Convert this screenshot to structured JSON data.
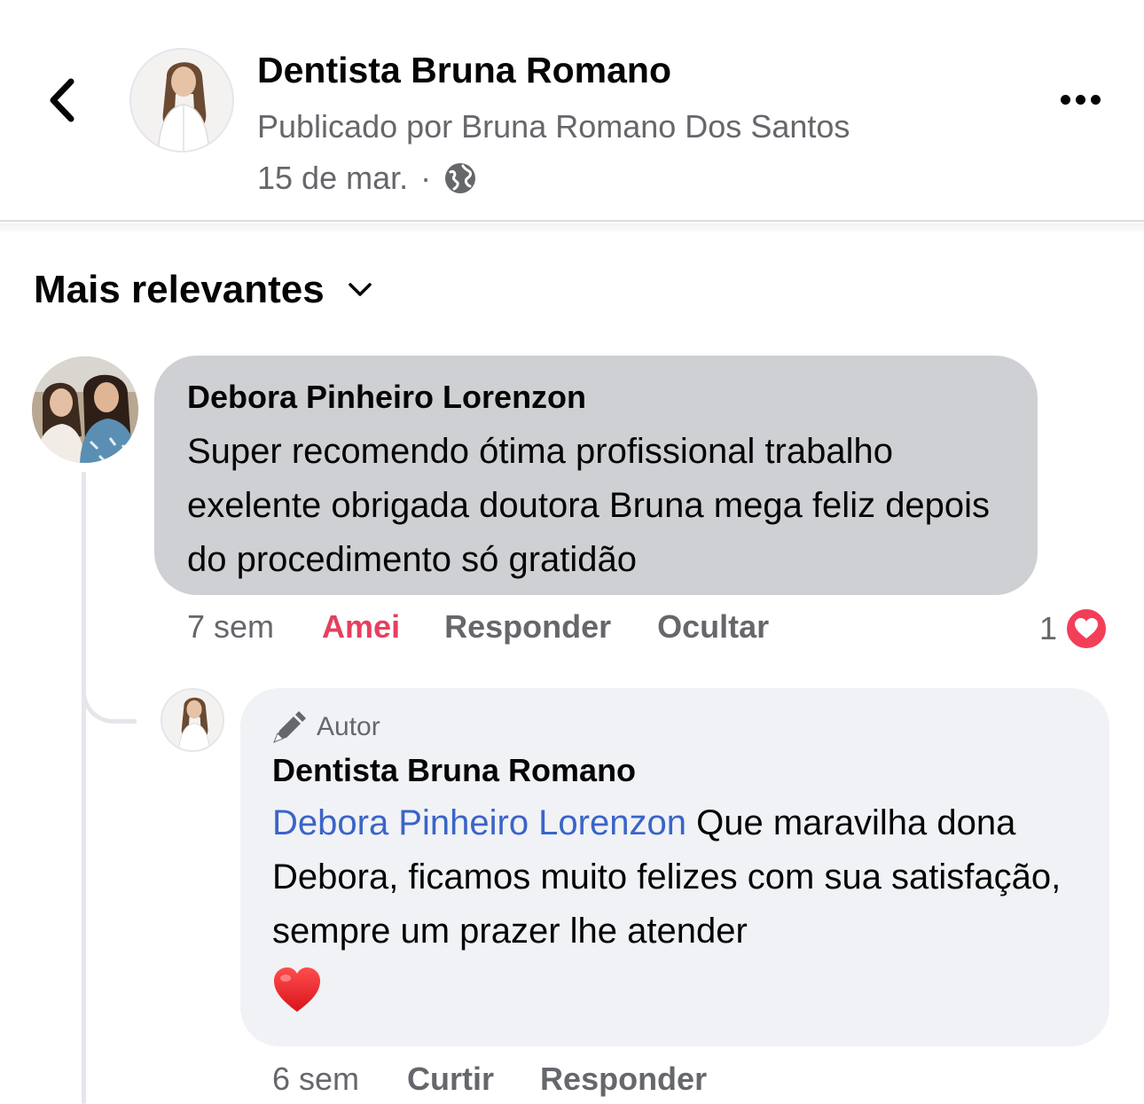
{
  "header": {
    "page_name": "Dentista Bruna Romano",
    "published_by": "Publicado por Bruna Romano Dos Santos",
    "date": "15 de mar.",
    "separator": "·",
    "privacy_icon": "globe-icon",
    "back_icon": "chevron-left-icon",
    "more_icon": "more-horizontal-icon"
  },
  "sort": {
    "label": "Mais relevantes",
    "icon": "chevron-down-icon"
  },
  "comments": [
    {
      "author": "Debora Pinheiro Lorenzon",
      "text": "Super recomendo ótima profissional trabalho exelente obrigada doutora Bruna mega feliz depois do procedimento só gratidão",
      "time": "7 sem",
      "reaction_label": "Amei",
      "reply_label": "Responder",
      "hide_label": "Ocultar",
      "reaction_count": "1",
      "reaction_icon": "heart-icon"
    }
  ],
  "reply": {
    "badge_label": "Autor",
    "badge_icon": "pen-icon",
    "author": "Dentista Bruna Romano",
    "mention": "Debora Pinheiro Lorenzon",
    "text": " Que maravilha dona Debora, ficamos muito felizes com sua satisfação, sempre um prazer lhe atender",
    "emoji": "red-heart-emoji",
    "time": "6 sem",
    "like_label": "Curtir",
    "reply_label": "Responder"
  },
  "colors": {
    "accent_link": "#3a64c8",
    "loved": "#e4405f",
    "heart": "#f33e58",
    "secondary_text": "#65676b"
  }
}
